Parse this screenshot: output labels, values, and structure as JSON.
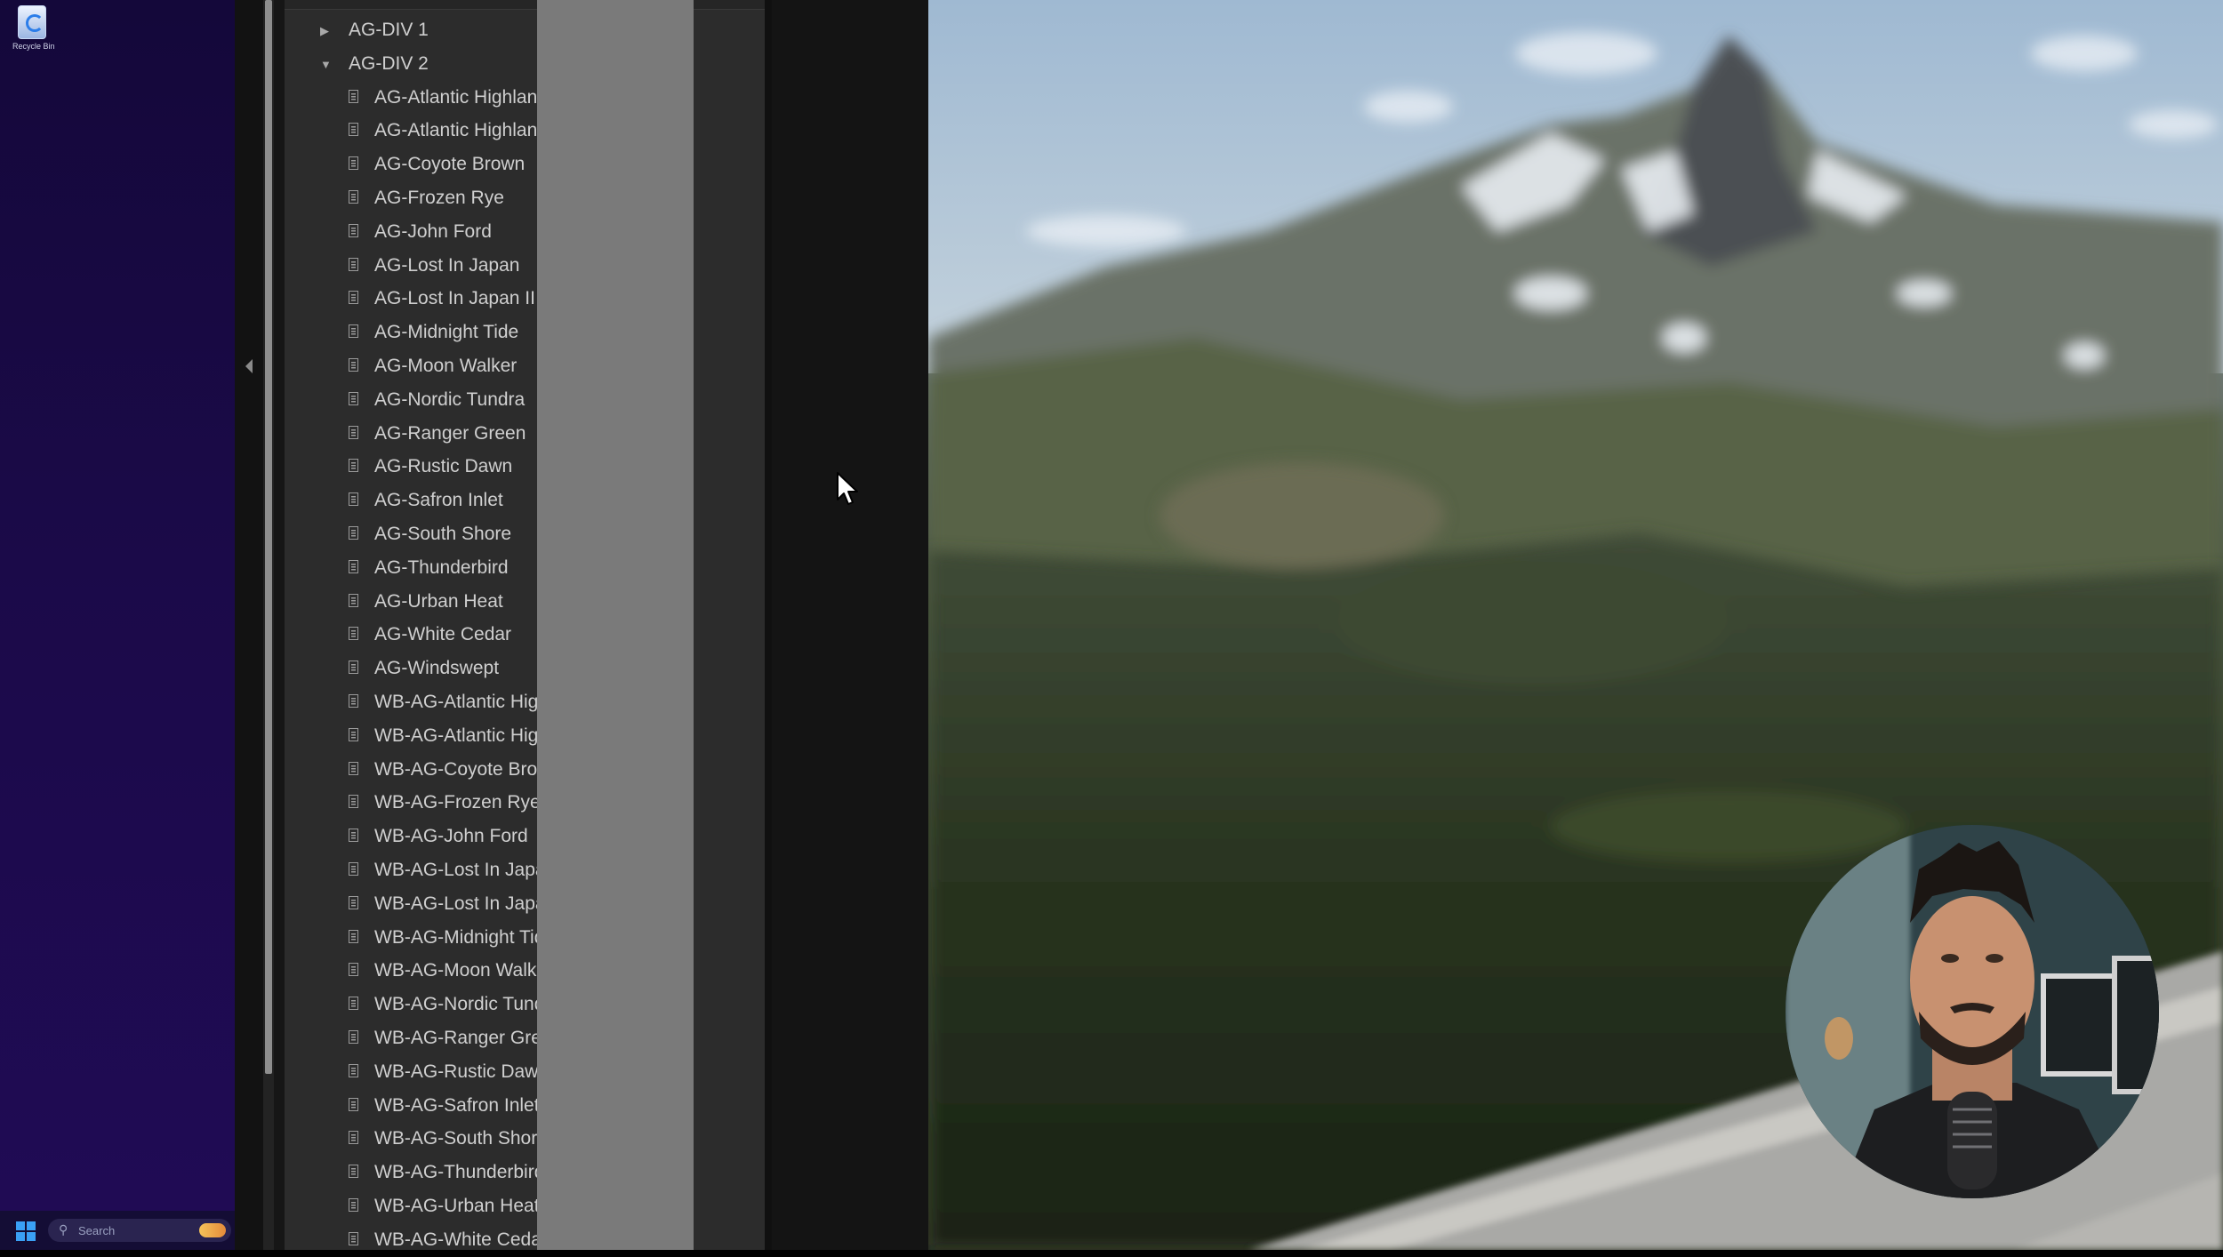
{
  "desktop": {
    "recycle_bin_label": "Recycle Bin",
    "taskbar_search_placeholder": "Search"
  },
  "folders": [
    {
      "label": "AG-DIV 1",
      "expanded": false
    },
    {
      "label": "AG-DIV 2",
      "expanded": true
    }
  ],
  "presets": [
    "AG-Atlantic Highlands",
    "AG-Atlantic Highlands II",
    "AG-Coyote Brown",
    "AG-Frozen Rye",
    "AG-John Ford",
    "AG-Lost In Japan",
    "AG-Lost In Japan II",
    "AG-Midnight Tide",
    "AG-Moon Walker",
    "AG-Nordic Tundra",
    "AG-Ranger Green",
    "AG-Rustic Dawn",
    "AG-Safron Inlet",
    "AG-South Shore",
    "AG-Thunderbird",
    "AG-Urban Heat",
    "AG-White Cedar",
    "AG-Windswept",
    "WB-AG-Atlantic Highlands",
    "WB-AG-Atlantic Highlands II",
    "WB-AG-Coyote Brown",
    "WB-AG-Frozen Rye",
    "WB-AG-John Ford",
    "WB-AG-Lost In Japan",
    "WB-AG-Lost In Japan II",
    "WB-AG-Midnight Tide",
    "WB-AG-Moon Walker",
    "WB-AG-Nordic Tundra",
    "WB-AG-Ranger Green",
    "WB-AG-Rustic Dawn",
    "WB-AG-Safron Inlet",
    "WB-AG-South Shore",
    "WB-AG-Thunderbird",
    "WB-AG-Urban Heat",
    "WB-AG-White Cedar"
  ],
  "icons": {
    "collapsed": "triangle-right-icon",
    "expanded": "triangle-down-icon",
    "preset": "document-icon"
  },
  "colors": {
    "panel_bg": "#2c2c2c",
    "text": "#cfcfcf",
    "desktop_bg": "#1b0a49"
  }
}
